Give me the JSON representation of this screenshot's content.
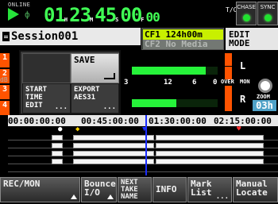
{
  "transport": {
    "online_label": "ONLINE",
    "speaker_symbol": "ф"
  },
  "timecode": {
    "hours": "01",
    "h_unit": "H",
    "minutes": "23",
    "m_unit": "M",
    "seconds": "45",
    "s_unit": "S",
    "frames": "00",
    "f_unit": "F",
    "subframes": "00",
    "badge": "T/C"
  },
  "status": {
    "chase_label": "CHASE",
    "sync_label": "SYNC",
    "colors": {
      "led_on": "#20e12f",
      "timecode": "#40ff54",
      "accent": "#ff5300",
      "cf1_bg": "#c8f000",
      "playhead": "#1a2cff",
      "zoom_bg": "#4fa2c8"
    }
  },
  "session": {
    "name": "Session001"
  },
  "media": {
    "cf1": "CF1 124h00m",
    "cf2": "CF2 No Media"
  },
  "mode": {
    "line1": "EDIT",
    "line2": "MODE"
  },
  "track_numbers": [
    "1",
    "2",
    "3",
    "4"
  ],
  "meter": {
    "db_label": "dB",
    "scale": [
      "3",
      "12",
      "6",
      "0"
    ],
    "over_label": "OVER",
    "mon_label": "MON",
    "left_label": "L",
    "right_label": "R",
    "left_level": 0.86,
    "right_level": 0.52
  },
  "zoom": {
    "label": "ZOOM",
    "value": "03h"
  },
  "popup_menu": {
    "save_label": "SAVE",
    "start_time_label": "START TIME EDIT",
    "export_label": "EXPORT AES31",
    "dots": "..."
  },
  "ruler": {
    "ticks": [
      "00:00:00:00",
      "00:45:00:00",
      "01:30:00:00",
      "02:15:00:00"
    ]
  },
  "function_keys": [
    {
      "label": "REC/MON"
    },
    {
      "label": "Bounce I/O"
    },
    {
      "label": "NEXT TAKE NAME"
    },
    {
      "label": "INFO"
    },
    {
      "label": "Mark List"
    },
    {
      "label": "Manual Locate"
    }
  ]
}
